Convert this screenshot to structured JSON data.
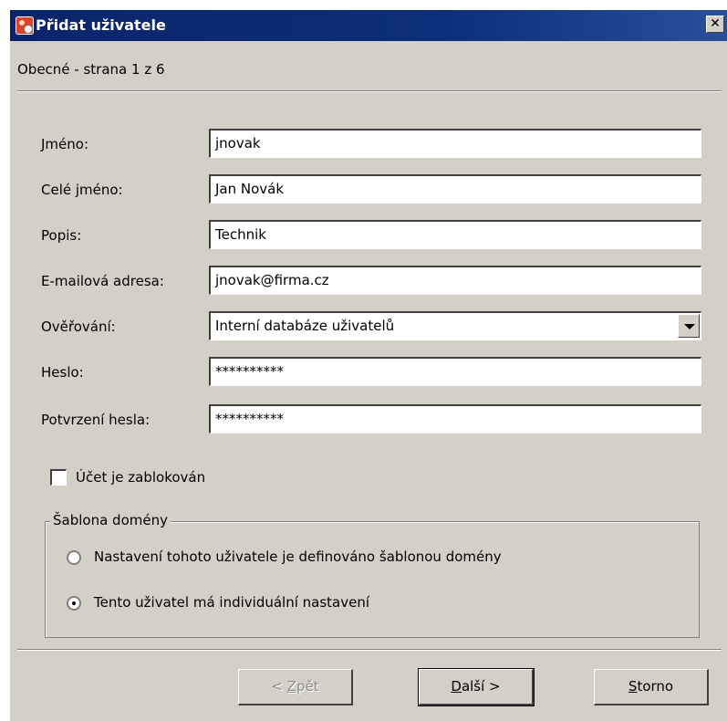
{
  "window": {
    "title": "Přidat uživatele",
    "close_glyph": "✕"
  },
  "page": {
    "subtitle": "Obecné - strana 1 z 6"
  },
  "form": {
    "username_label": "Jméno:",
    "username_value": "jnovak",
    "fullname_label": "Celé jméno:",
    "fullname_value": "Jan Novák",
    "description_label": "Popis:",
    "description_value": "Technik",
    "email_label": "E-mailová adresa:",
    "email_value": "jnovak@firma.cz",
    "auth_label": "Ověřování:",
    "auth_value": "Interní databáze uživatelů",
    "password_label": "Heslo:",
    "password_value": "**********",
    "password_confirm_label": "Potvrzení hesla:",
    "password_confirm_value": "**********",
    "account_locked_label": "Účet je zablokován",
    "account_locked_checked": false
  },
  "domain_template": {
    "title": "Šablona domény",
    "option_template_label": "Nastavení tohoto uživatele je definováno šablonou domény",
    "option_individual_label": "Tento uživatel má individuální nastavení",
    "selected": "individual"
  },
  "buttons": {
    "back_prefix": "< ",
    "back_mnemonic": "Z",
    "back_rest": "pět",
    "next_mnemonic": "D",
    "next_rest": "alší >",
    "cancel_mnemonic": "S",
    "cancel_rest": "torno"
  },
  "colors": {
    "titlebar": "#0a246a",
    "dialog_bg": "#d4d0c8"
  },
  "icons": {
    "app": "user-add-icon",
    "dropdown": "chevron-down-icon"
  }
}
